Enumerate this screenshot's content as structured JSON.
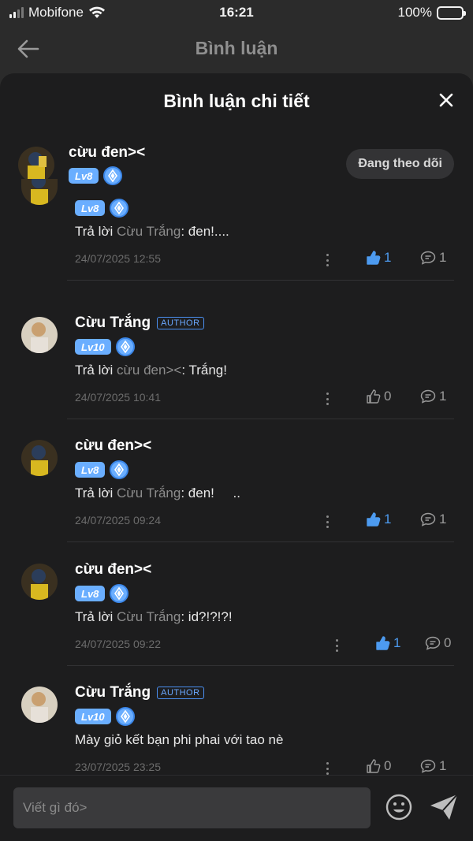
{
  "status": {
    "carrier": "Mobifone",
    "time": "16:21",
    "battery": "100%"
  },
  "topbar": {
    "title": "Bình luận"
  },
  "sheet": {
    "title": "Bình luận chi tiết"
  },
  "parent": {
    "name": "cừu đen><",
    "level": "Lv8",
    "follow_label": "Đang theo dõi"
  },
  "replies": [
    {
      "name": "cừu đen><",
      "author": "",
      "level": "Lv8",
      "prefix": "Trả lời ",
      "ref": "Cừu Trắng",
      "text": ": đen!....",
      "time": "24/07/2025 12:55",
      "likes": "1",
      "liked": true,
      "comments": "1"
    },
    {
      "name": "Cừu Trắng",
      "author": "AUTHOR",
      "level": "Lv10",
      "prefix": "Trả lời ",
      "ref": "cừu đen><",
      "text": ": Trắng!",
      "time": "24/07/2025 10:41",
      "likes": "0",
      "liked": false,
      "comments": "1"
    },
    {
      "name": "cừu đen><",
      "author": "",
      "level": "Lv8",
      "prefix": "Trả lời ",
      "ref": "Cừu Trắng",
      "text": ": đen!     ..",
      "time": "24/07/2025 09:24",
      "likes": "1",
      "liked": true,
      "comments": "1"
    },
    {
      "name": "cừu đen><",
      "author": "",
      "level": "Lv8",
      "prefix": "Trả lời ",
      "ref": "Cừu Trắng",
      "text": ": id?!?!?!",
      "time": "24/07/2025 09:22",
      "likes": "1",
      "liked": true,
      "comments": "0"
    },
    {
      "name": "Cừu Trắng",
      "author": "AUTHOR",
      "level": "Lv10",
      "prefix": "",
      "ref": "",
      "text": "Mày giỏ kết bạn phi phai với tao nè",
      "time": "23/07/2025 23:25",
      "likes": "0",
      "liked": false,
      "comments": "1"
    }
  ],
  "composer": {
    "placeholder": "Viết gì đó>"
  },
  "colors": {
    "accent": "#4d9bf0",
    "level_badge": "#6aaeff",
    "sheet_bg": "#1d1d1e"
  },
  "icons": [
    "back-arrow-icon",
    "close-icon",
    "thumbs-up-icon",
    "comment-icon",
    "more-vertical-icon",
    "emoji-icon",
    "send-icon",
    "diamond-badge-icon"
  ]
}
